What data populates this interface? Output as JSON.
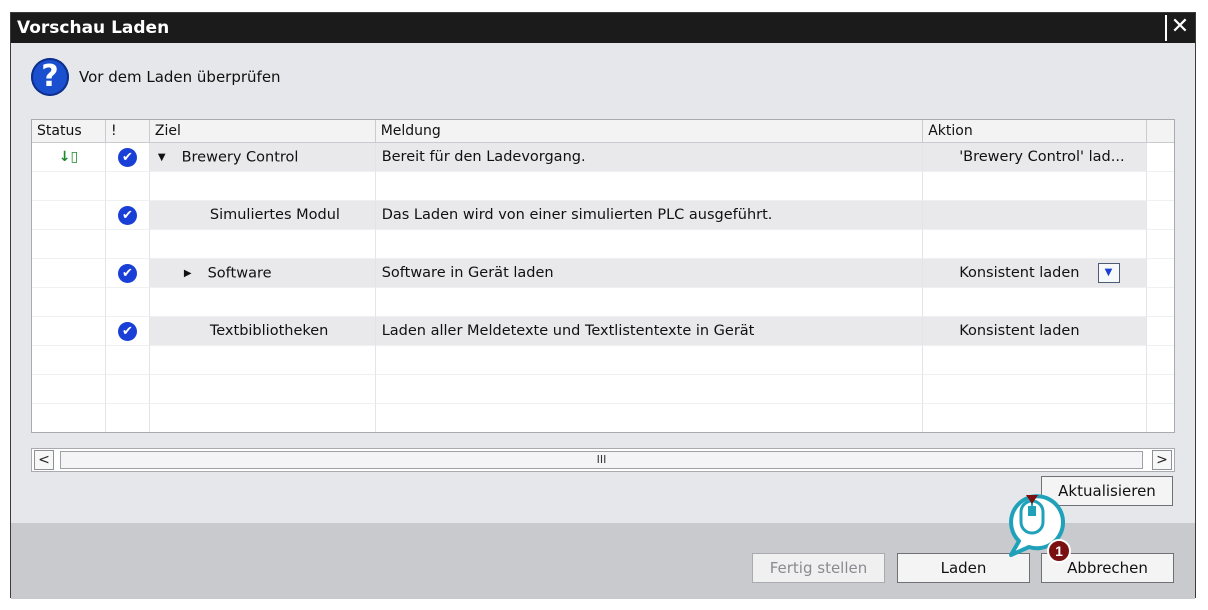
{
  "dialog": {
    "title": "Vorschau Laden",
    "close_label": "✕",
    "header_text": "Vor dem Laden überprüfen"
  },
  "table": {
    "columns": [
      "Status",
      "!",
      "Ziel",
      "Meldung",
      "Aktion"
    ],
    "rows": [
      {
        "status": "↓▯",
        "check": true,
        "target": "Brewery Control",
        "expander": "▼",
        "indent": 0,
        "message": "Bereit für den Ladevorgang.",
        "action": "'Brewery Control' lad...",
        "shaded": true,
        "dropdown": false
      },
      {
        "status": "",
        "check": false,
        "target": "",
        "expander": "",
        "indent": 0,
        "message": "",
        "action": "",
        "shaded": false,
        "dropdown": false
      },
      {
        "status": "",
        "check": true,
        "target": "Simuliertes Modul",
        "expander": "",
        "indent": 2,
        "message": "Das Laden wird von einer simulierten PLC ausgeführt.",
        "action": "",
        "shaded": true,
        "dropdown": false
      },
      {
        "status": "",
        "check": false,
        "target": "",
        "expander": "",
        "indent": 0,
        "message": "",
        "action": "",
        "shaded": false,
        "dropdown": false
      },
      {
        "status": "",
        "check": true,
        "target": "Software",
        "expander": "▶",
        "indent": 1,
        "message": "Software in Gerät laden",
        "action": "Konsistent laden",
        "shaded": true,
        "dropdown": true
      },
      {
        "status": "",
        "check": false,
        "target": "",
        "expander": "",
        "indent": 0,
        "message": "",
        "action": "",
        "shaded": false,
        "dropdown": false
      },
      {
        "status": "",
        "check": true,
        "target": "Textbibliotheken",
        "expander": "",
        "indent": 2,
        "message": "Laden aller Meldetexte und Textlistentexte in Gerät",
        "action": "Konsistent laden",
        "shaded": true,
        "dropdown": false
      },
      {
        "status": "",
        "check": false,
        "target": "",
        "expander": "",
        "indent": 0,
        "message": "",
        "action": "",
        "shaded": false,
        "dropdown": false
      },
      {
        "status": "",
        "check": false,
        "target": "",
        "expander": "",
        "indent": 0,
        "message": "",
        "action": "",
        "shaded": false,
        "dropdown": false
      },
      {
        "status": "",
        "check": false,
        "target": "",
        "expander": "",
        "indent": 0,
        "message": "",
        "action": "",
        "shaded": false,
        "dropdown": false
      }
    ]
  },
  "scrollbar": {
    "left": "<",
    "right": ">",
    "grip": "III"
  },
  "buttons": {
    "refresh": "Aktualisieren",
    "finish": "Fertig stellen",
    "load": "Laden",
    "cancel": "Abbrechen"
  },
  "callout": {
    "number": "1"
  },
  "colors": {
    "titlebar": "#1b1b1b",
    "accent": "#1a3fd6",
    "callout": "#1fa1ba",
    "marker": "#7a1010"
  }
}
